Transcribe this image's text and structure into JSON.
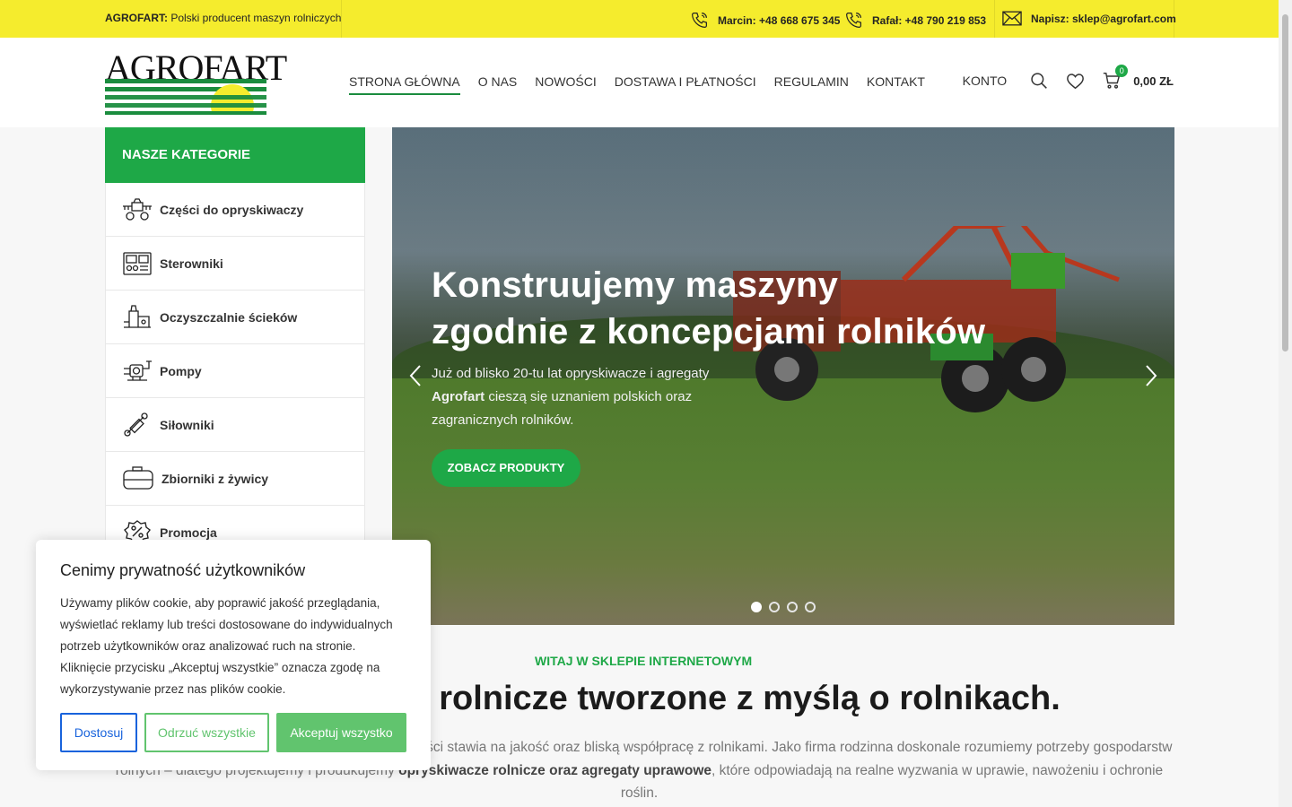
{
  "topbar": {
    "brand": "AGROFART:",
    "tagline": " Polski producent maszyn rolniczych",
    "phone1": "Marcin: +48 668 675 345",
    "phone2": "Rafał: +48 790 219 853",
    "email": "Napisz: sklep@agrofart.com"
  },
  "header": {
    "logo_text": "AGROFART",
    "nav": [
      "STRONA GŁÓWNA",
      "O NAS",
      "NOWOŚCI",
      "DOSTAWA I PŁATNOŚCI",
      "REGULAMIN",
      "KONTAKT"
    ],
    "account": "KONTO",
    "cart_count": "0",
    "cart_total": "0,00 ZŁ"
  },
  "categories": {
    "title": "NASZE KATEGORIE",
    "items": [
      "Części do opryskiwaczy",
      "Sterowniki",
      "Oczyszczalnie ścieków",
      "Pompy",
      "Siłowniki",
      "Zbiorniki z żywicy",
      "Promocja"
    ]
  },
  "hero": {
    "title_line1": "Konstruujemy maszyny",
    "title_line2": "zgodnie z koncepcjami rolników",
    "desc_a": "Już od blisko 20-tu lat opryskiwacze i agregaty ",
    "desc_brand": "Agrofart",
    "desc_b": " cieszą się uznaniem polskich oraz zagranicznych rolników.",
    "button": "ZOBACZ PRODUKTY",
    "slide_count": 4,
    "active_slide": 1
  },
  "welcome": {
    "kicker": "WITAJ W SKLEPIE INTERNETOWYM",
    "title": "yny rolnicze tworzone z myślą o rolnikach.",
    "text_a": "wieloletnim doświadczeniem. Od początku działalności stawia na jakość oraz bliską współpracę z rolnikami. Jako firma rodzinna doskonale rozumiemy potrzeby gospodarstw rolnych – dlatego projektujemy i produkujemy ",
    "text_bold": "opryskiwacze rolnicze oraz agregaty uprawowe",
    "text_b": ", które odpowiadają na realne wyzwania w uprawie, nawożeniu i ochronie roślin."
  },
  "cookie": {
    "title": "Cenimy prywatność użytkowników",
    "text": "Używamy plików cookie, aby poprawić jakość przeglądania, wyświetlać reklamy lub treści dostosowane do indywidualnych potrzeb użytkowników oraz analizować ruch na stronie. Kliknięcie przycisku „Akceptuj wszystkie” oznacza zgodę na wykorzystywanie przez nas plików cookie.",
    "btn_customize": "Dostosuj",
    "btn_reject": "Odrzuć wszystkie",
    "btn_accept": "Akceptuj wszystko"
  },
  "colors": {
    "topbar": "#f5ec2d",
    "brand_green": "#1ea847",
    "customize_blue": "#1863dc",
    "cookie_green": "#61c46e"
  },
  "icons": [
    "phone-icon",
    "mail-icon",
    "search-icon",
    "heart-icon",
    "cart-icon",
    "chevron-left-icon",
    "chevron-right-icon"
  ]
}
